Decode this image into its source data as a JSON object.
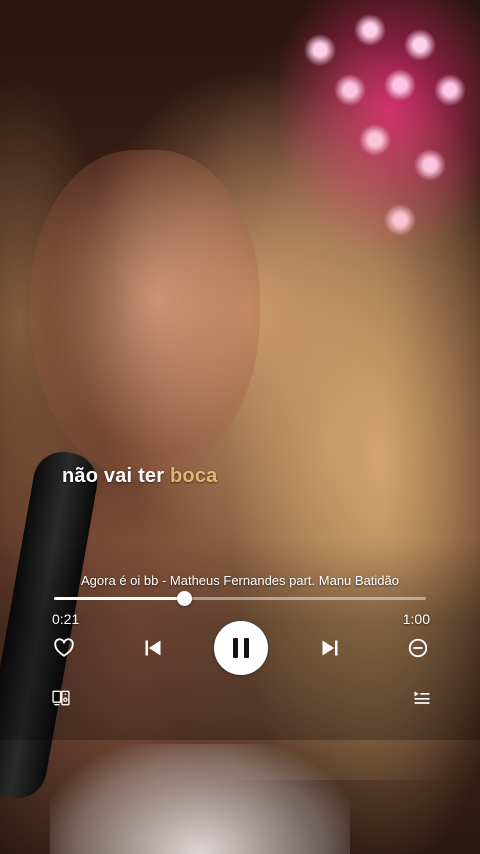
{
  "lyrics": {
    "sung": "não vai ter ",
    "upcoming": "boca"
  },
  "track": {
    "title": "Agora é oi bb - Matheus Fernandes part. Manu Batidão",
    "elapsed": "0:21",
    "duration": "1:00",
    "progress": 0.35
  },
  "controls": {
    "like_icon": "heart-outline-icon",
    "previous_icon": "skip-previous-icon",
    "play_pause_icon": "pause-icon",
    "next_icon": "skip-next-icon",
    "remove_icon": "minus-circle-icon",
    "devices_icon": "connect-devices-icon",
    "queue_icon": "queue-icon"
  },
  "colors": {
    "accent": "#ffffff",
    "lyric_upcoming": "#f5cd78"
  }
}
